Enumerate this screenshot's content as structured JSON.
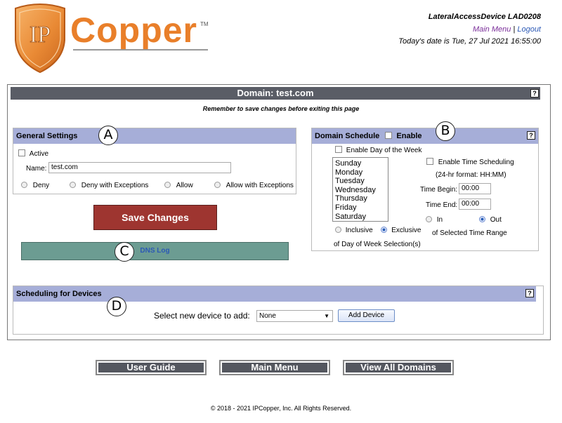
{
  "header": {
    "logo_text": "IP",
    "brand_word": "Copper",
    "trademark": "TM",
    "device_name": "LateralAccessDevice LAD0208",
    "main_menu_link": "Main Menu",
    "separator": "|",
    "logout_link": "Logout",
    "date_text": "Today's date is Tue, 27 Jul 2021 16:55:00"
  },
  "main": {
    "title": "Domain: test.com",
    "help": "?",
    "reminder": "Remember to save changes before exiting this page"
  },
  "general": {
    "title": "General Settings",
    "marker": "A",
    "active_label": "Active",
    "active_checked": false,
    "name_label": "Name:",
    "name_value": "test.com",
    "options": [
      "Deny",
      "Deny with Exceptions",
      "Allow",
      "Allow with Exceptions"
    ],
    "selected_option": null
  },
  "save_label": "Save Changes",
  "dns": {
    "marker": "C",
    "label": "DNS Log"
  },
  "schedule": {
    "title": "Domain Schedule",
    "enable_label": "Enable",
    "marker": "B",
    "help": "?",
    "enable_dow_label": "Enable Day of the Week",
    "days": [
      "Sunday",
      "Monday",
      "Tuesday",
      "Wednesday",
      "Thursday",
      "Friday",
      "Saturday"
    ],
    "inclusive_label": "Inclusive",
    "exclusive_label": "Exclusive",
    "dow_mode": "Exclusive",
    "dow_suffix": "of Day of Week Selection(s)",
    "enable_time_label": "Enable Time Scheduling",
    "format_note": "(24-hr format: HH:MM)",
    "time_begin_label": "Time Begin:",
    "time_begin_value": "00:00",
    "time_end_label": "Time End:",
    "time_end_value": "00:00",
    "in_label": "In",
    "out_label": "Out",
    "range_mode": "Out",
    "range_suffix": "of Selected Time Range"
  },
  "devices": {
    "title": "Scheduling for Devices",
    "marker": "D",
    "help": "?",
    "select_label": "Select new device to add:",
    "select_value": "None",
    "add_button": "Add Device"
  },
  "nav": {
    "user_guide": "User Guide",
    "main_menu": "Main Menu",
    "view_all": "View All Domains"
  },
  "footer": "© 2018 - 2021 IPCopper, Inc. All Rights Reserved.",
  "colors": {
    "brand_orange": "#e97f2a",
    "title_bar": "#5a5d66",
    "section_bar": "#a6aed8",
    "save_button": "#9e3530",
    "dns_bar": "#6c9c92",
    "link_purple": "#7b2f9a",
    "link_blue": "#2c59b5"
  }
}
